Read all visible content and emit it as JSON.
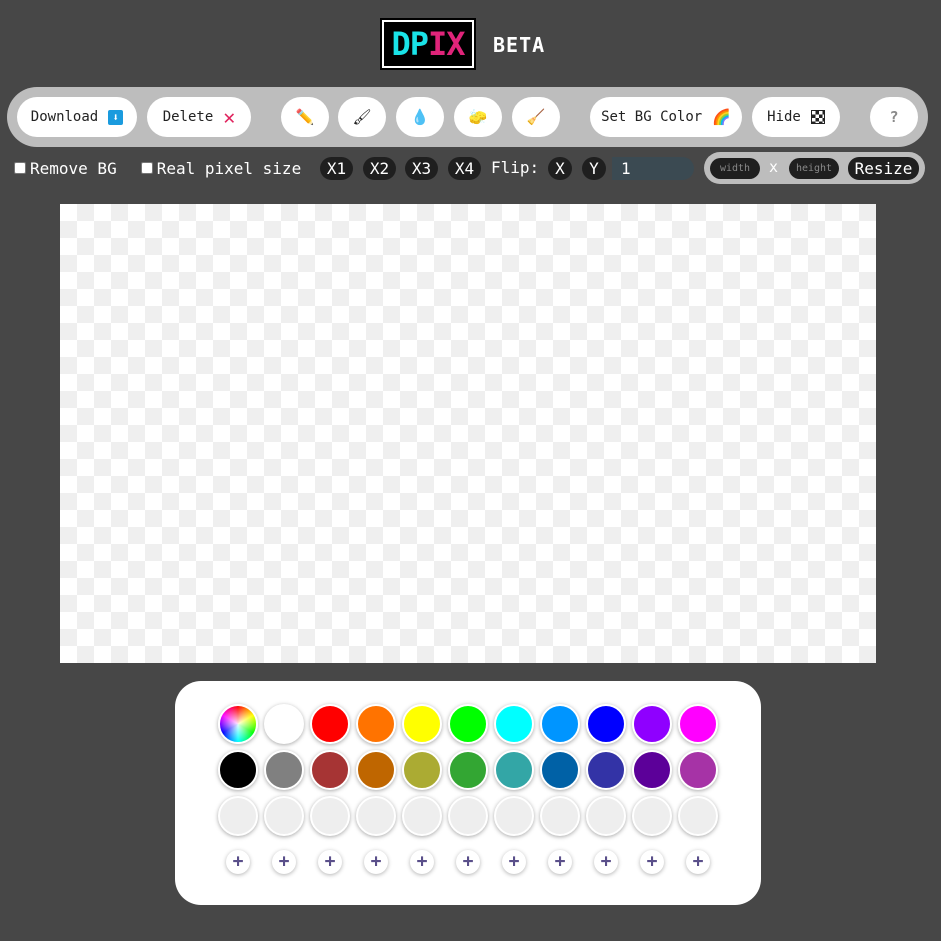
{
  "header": {
    "logo_text": "DPIX",
    "beta_label": "BETA"
  },
  "toolbar": {
    "download_label": "Download",
    "download_icon": "⬇",
    "delete_label": "Delete",
    "delete_icon": "✕",
    "tools": [
      {
        "name": "pencil",
        "icon": "✏️"
      },
      {
        "name": "brush",
        "icon": "🖌"
      },
      {
        "name": "fill",
        "icon": "💧"
      },
      {
        "name": "eraser",
        "icon": "🧽"
      },
      {
        "name": "broom",
        "icon": "🧹"
      }
    ],
    "set_bg_label": "Set BG Color",
    "set_bg_icon": "🌈",
    "hide_label": "Hide",
    "help_label": "?"
  },
  "options": {
    "remove_bg_label": "Remove BG",
    "real_pixel_label": "Real pixel size",
    "zoom": [
      "X1",
      "X2",
      "X3",
      "X4"
    ],
    "flip_label": "Flip:",
    "flip_x": "X",
    "flip_y": "Y",
    "size_value": "1"
  },
  "resize": {
    "width_placeholder": "width",
    "separator": "x",
    "height_placeholder": "height",
    "button_label": "Resize"
  },
  "palette": {
    "row1": [
      "rainbow",
      "#ffffff",
      "#ff0000",
      "#ff7300",
      "#ffff00",
      "#00ff00",
      "#00ffff",
      "#0095ff",
      "#0000ff",
      "#8f00ff",
      "#ff00ff"
    ],
    "row2": [
      "#000000",
      "#808080",
      "#a63434",
      "#bf6600",
      "#abab33",
      "#33a633",
      "#33a6a6",
      "#0061a6",
      "#3333a6",
      "#5c0099",
      "#a633a6"
    ],
    "row3": [
      "#eeeeee",
      "#eeeeee",
      "#eeeeee",
      "#eeeeee",
      "#eeeeee",
      "#eeeeee",
      "#eeeeee",
      "#eeeeee",
      "#eeeeee",
      "#eeeeee",
      "#eeeeee"
    ],
    "add_label": "+"
  }
}
